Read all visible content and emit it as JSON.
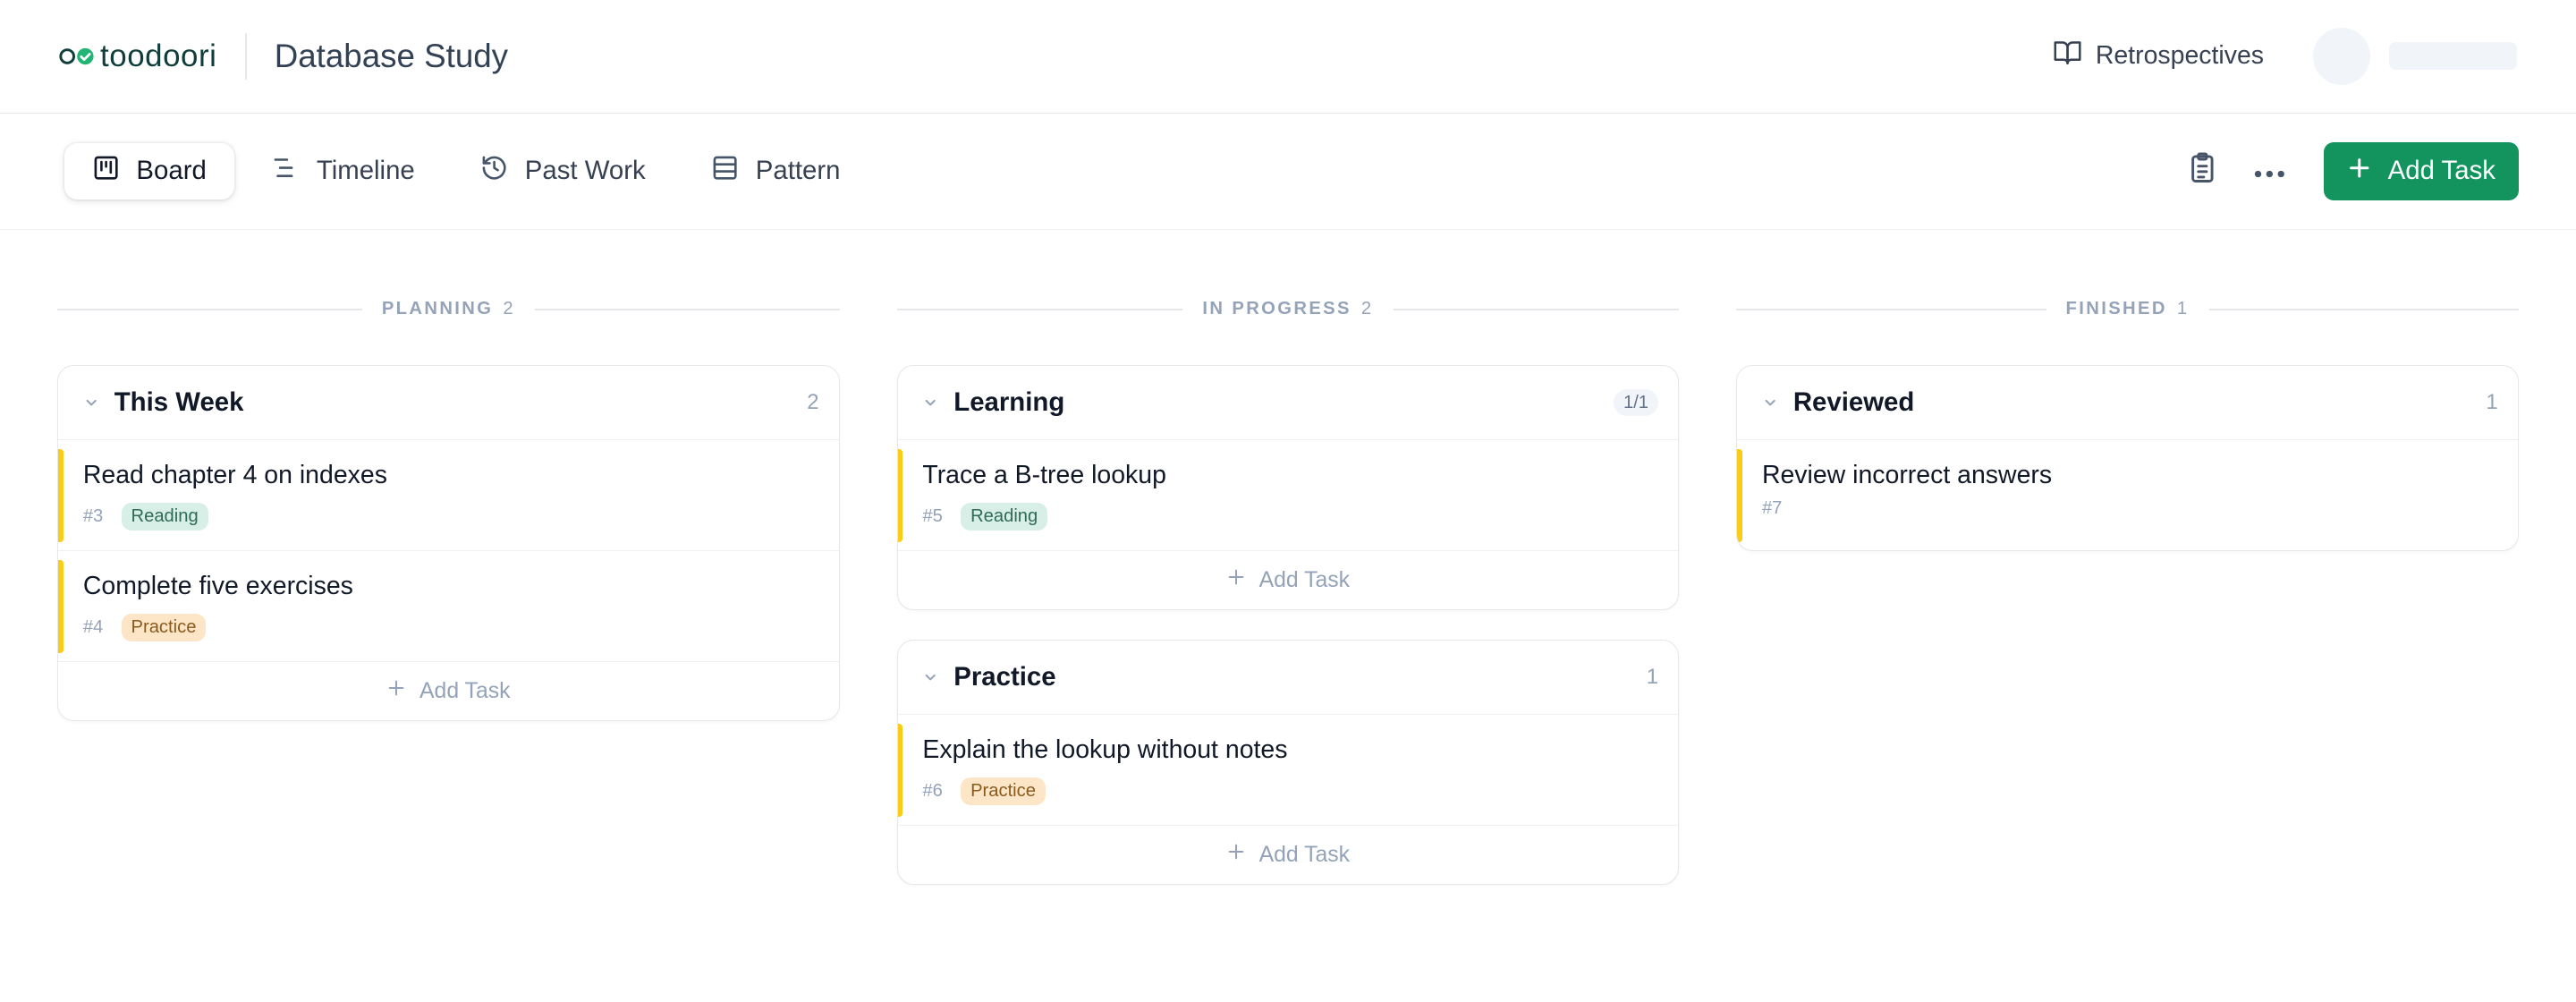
{
  "app": {
    "logo_text": "toodoori",
    "project_title": "Database Study",
    "retrospectives_label": "Retrospectives"
  },
  "tabs": [
    {
      "label": "Board",
      "icon": "board-icon",
      "active": true
    },
    {
      "label": "Timeline",
      "icon": "timeline-icon",
      "active": false
    },
    {
      "label": "Past Work",
      "icon": "history-icon",
      "active": false
    },
    {
      "label": "Pattern",
      "icon": "pattern-icon",
      "active": false
    }
  ],
  "toolbar": {
    "add_task_label": "Add Task",
    "accent_color": "#13935e"
  },
  "columns": [
    {
      "title": "PLANNING",
      "count": "2",
      "groups": [
        {
          "name": "This Week",
          "count": "2",
          "tasks": [
            {
              "title": "Read chapter 4 on indexes",
              "id": "#3",
              "tag": "Reading"
            },
            {
              "title": "Complete five exercises",
              "id": "#4",
              "tag": "Practice"
            }
          ],
          "add_label": "Add Task"
        }
      ]
    },
    {
      "title": "IN PROGRESS",
      "count": "2",
      "groups": [
        {
          "name": "Learning",
          "count": "1/1",
          "tasks": [
            {
              "title": "Trace a B-tree lookup",
              "id": "#5",
              "tag": "Reading"
            }
          ],
          "add_label": "Add Task"
        },
        {
          "name": "Practice",
          "count": "1",
          "tasks": [
            {
              "title": "Explain the lookup without notes",
              "id": "#6",
              "tag": "Practice"
            }
          ],
          "add_label": "Add Task"
        }
      ]
    },
    {
      "title": "FINISHED",
      "count": "1",
      "groups": [
        {
          "name": "Reviewed",
          "count": "1",
          "tasks": [
            {
              "title": "Review incorrect answers",
              "id": "#7",
              "tag": ""
            }
          ]
        }
      ]
    }
  ],
  "colors": {
    "task_accent": "#facc15",
    "reading_tag_bg": "#d7efe7",
    "practice_tag_bg": "#fde6c8"
  }
}
